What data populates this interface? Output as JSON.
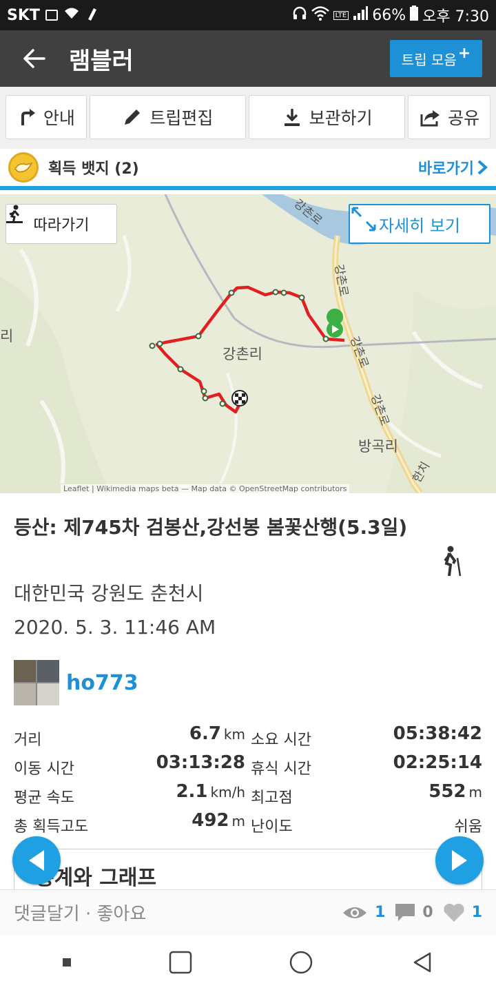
{
  "status_bar": {
    "carrier": "SKT",
    "battery": "66%",
    "time": "오후 7:30"
  },
  "app_bar": {
    "title": "램블러",
    "trip_collection_label": "트립 모음",
    "trip_collection_plus": "+"
  },
  "actions": {
    "guide": "안내",
    "edit": "트립편집",
    "save": "보관하기",
    "share": "공유"
  },
  "badges": {
    "label": "획득 뱃지 (2)",
    "goto": "바로가기"
  },
  "map": {
    "follow": "따라가기",
    "detail": "자세히 보기",
    "labels": {
      "village1": "강촌리",
      "village2": "방곡리",
      "road1": "강촌로",
      "road2": "강촌로",
      "road3": "강촌로",
      "road4": "한치",
      "edge": "리"
    },
    "attribution": "Leaflet | Wikimedia maps beta — Map data © OpenStreetMap contributors"
  },
  "trip": {
    "title": "등산: 제745차 검봉산,강선봉 봄꽃산행(5.3일)",
    "location": "대한민국 강원도 춘천시",
    "date": "2020. 5. 3. 11:46 AM",
    "username": "ho773"
  },
  "stats": {
    "distance_label": "거리",
    "distance_value": "6.7",
    "distance_unit": "km",
    "duration_label": "소요 시간",
    "duration_value": "05:38:42",
    "moving_label": "이동 시간",
    "moving_value": "03:13:28",
    "rest_label": "휴식 시간",
    "rest_value": "02:25:14",
    "speed_label": "평균 속도",
    "speed_value": "2.1",
    "speed_unit": "km/h",
    "max_label": "최고점",
    "max_value": "552",
    "max_unit": "m",
    "gain_label": "총 획득고도",
    "gain_value": "492",
    "gain_unit": "m",
    "difficulty_label": "난이도",
    "difficulty_value": "쉬움"
  },
  "graph_card": {
    "label": "통계와 그래프"
  },
  "comment_bar": {
    "text": "댓글달기 · 좋아요",
    "views": "1",
    "comments": "0",
    "likes": "1"
  },
  "colors": {
    "accent": "#1ea0e3",
    "track": "#e02020",
    "appbar": "#404040"
  }
}
